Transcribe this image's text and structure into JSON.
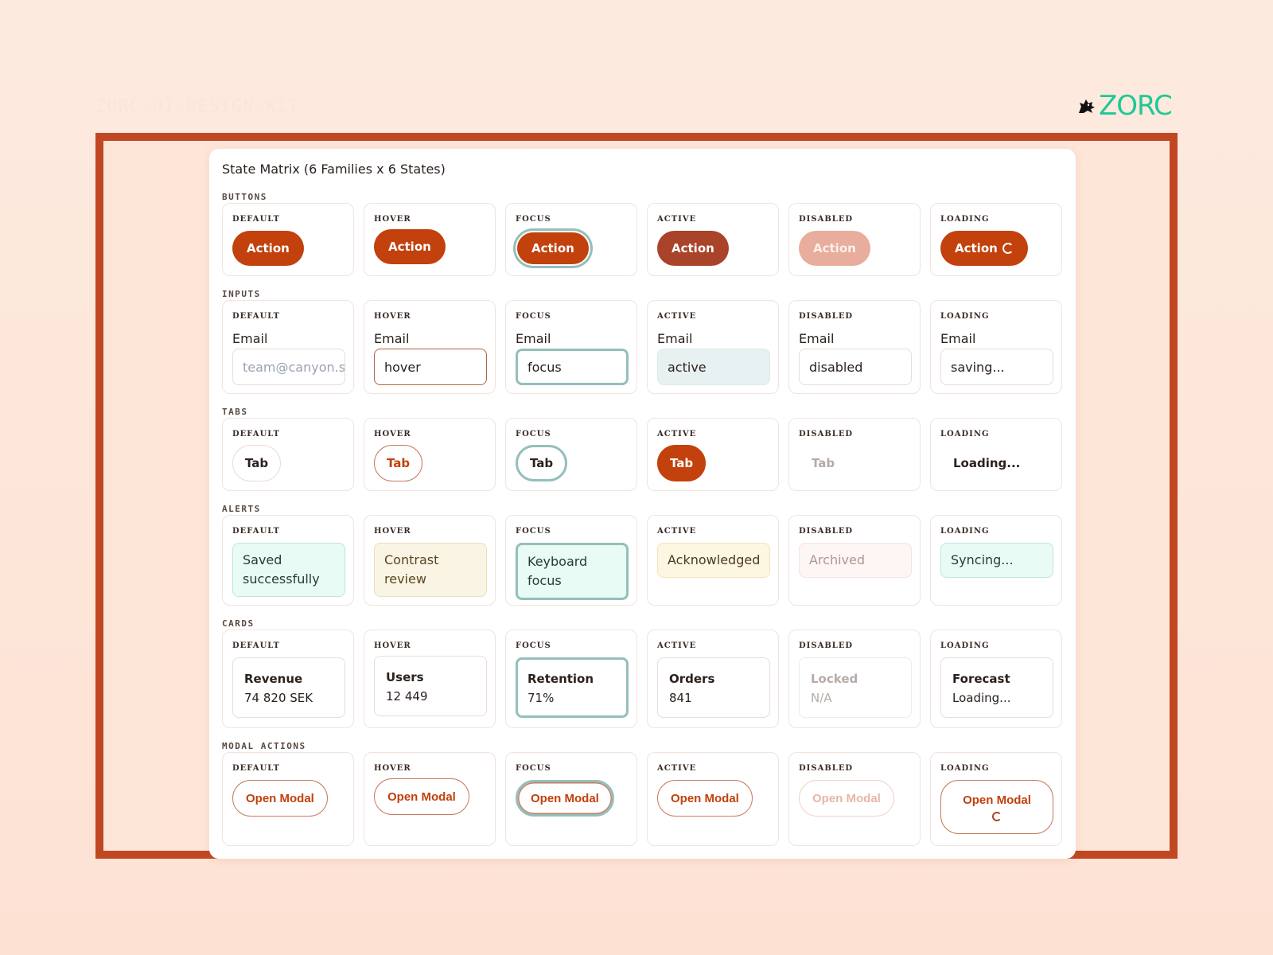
{
  "kit_title": "ZORC-UI-DESIGN-KIT",
  "logo": {
    "wordmark": "ZORC",
    "icon": "wolf-icon",
    "color": "#1ec995"
  },
  "colors": {
    "frame": "#c14722",
    "accent": "#c2410c",
    "focus_ring": "#94bfbc"
  },
  "panel_title": "State Matrix (6 Families x 6 States)",
  "states": [
    "DEFAULT",
    "HOVER",
    "FOCUS",
    "ACTIVE",
    "DISABLED",
    "LOADING"
  ],
  "families": {
    "buttons": {
      "label": "BUTTONS",
      "items": [
        "Action",
        "Action",
        "Action",
        "Action",
        "Action",
        "Action"
      ]
    },
    "inputs": {
      "label": "INPUTS",
      "field_label": "Email",
      "placeholder": "team@canyon.se",
      "values": [
        "",
        "hover",
        "focus",
        "active",
        "disabled",
        "saving..."
      ]
    },
    "tabs": {
      "label": "TABS",
      "items": [
        "Tab",
        "Tab",
        "Tab",
        "Tab",
        "Tab",
        "Loading..."
      ]
    },
    "alerts": {
      "label": "ALERTS",
      "items": [
        "Saved successfully",
        "Contrast review",
        "Keyboard focus",
        "Acknowledged",
        "Archived",
        "Syncing..."
      ]
    },
    "cards": {
      "label": "CARDS",
      "items": [
        {
          "title": "Revenue",
          "value": "74 820 SEK"
        },
        {
          "title": "Users",
          "value": "12 449"
        },
        {
          "title": "Retention",
          "value": "71%"
        },
        {
          "title": "Orders",
          "value": "841"
        },
        {
          "title": "Locked",
          "value": "N/A"
        },
        {
          "title": "Forecast",
          "value": "Loading..."
        }
      ]
    },
    "modal_actions": {
      "label": "MODAL ACTIONS",
      "items": [
        "Open Modal",
        "Open Modal",
        "Open Modal",
        "Open Modal",
        "Open Modal",
        "Open Modal"
      ]
    }
  }
}
